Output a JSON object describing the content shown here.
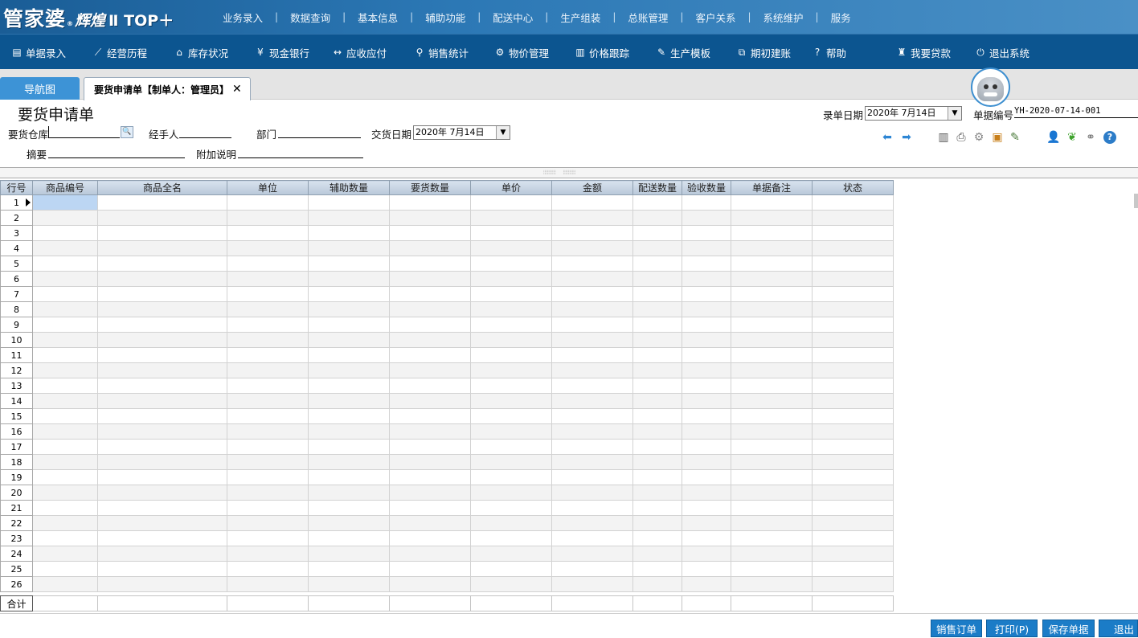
{
  "app": {
    "logo_main": "管家婆",
    "logo_reg": "®",
    "logo_sub": "辉煌",
    "logo_edition": "Ⅱ TOP＋"
  },
  "top_menu": [
    "业务录入",
    "数据查询",
    "基本信息",
    "辅助功能",
    "配送中心",
    "生产组装",
    "总账管理",
    "客户关系",
    "系统维护",
    "服务"
  ],
  "toolbar": [
    {
      "label": "单据录入",
      "icon": "document-icon",
      "glyph": "▤"
    },
    {
      "label": "经营历程",
      "icon": "chart-line-icon",
      "glyph": "⟋"
    },
    {
      "label": "库存状况",
      "icon": "home-icon",
      "glyph": "⌂"
    },
    {
      "label": "现金银行",
      "icon": "yen-icon",
      "glyph": "¥"
    },
    {
      "label": "应收应付",
      "icon": "arrows-icon",
      "glyph": "↔"
    },
    {
      "label": "销售统计",
      "icon": "search-icon",
      "glyph": "⚲"
    },
    {
      "label": "物价管理",
      "icon": "gear-icon",
      "glyph": "⚙"
    },
    {
      "label": "价格跟踪",
      "icon": "bar-chart-icon",
      "glyph": "▥"
    },
    {
      "label": "生产模板",
      "icon": "wrench-icon",
      "glyph": "✎"
    },
    {
      "label": "期初建账",
      "icon": "external-link-icon",
      "glyph": "⧉"
    },
    {
      "label": "帮助",
      "icon": "question-icon",
      "glyph": "?"
    },
    {
      "label": "我要贷款",
      "icon": "money-bag-icon",
      "glyph": "♜"
    },
    {
      "label": "退出系统",
      "icon": "power-icon",
      "glyph": "⏻"
    }
  ],
  "tabs": {
    "nav": "导航图",
    "doc": "要货申请单【制单人：管理员】",
    "close": "✕"
  },
  "form": {
    "title": "要货申请单",
    "warehouse_label": "要货仓库",
    "warehouse_value": "",
    "handler_label": "经手人",
    "handler_value": "",
    "dept_label": "部门",
    "dept_value": "",
    "delivery_date_label": "交货日期",
    "delivery_date_value": "2020年  7月14日",
    "summary_label": "摘要",
    "summary_value": "",
    "note_label": "附加说明",
    "note_value": "",
    "entry_date_label": "录单日期",
    "entry_date_value": "2020年  7月14日",
    "doc_no_label": "单据编号",
    "doc_no_value": "YH-2020-07-14-001"
  },
  "grid": {
    "columns": [
      "行号",
      "商品编号",
      "商品全名",
      "单位",
      "辅助数量",
      "要货数量",
      "单价",
      "金额",
      "配送数量",
      "验收数量",
      "单据备注",
      "状态"
    ],
    "row_count": 26,
    "total_label": "合计"
  },
  "buttons": {
    "sales_order": "销售订单",
    "print": "打印(P)",
    "save": "保存单据",
    "exit": "退出"
  }
}
